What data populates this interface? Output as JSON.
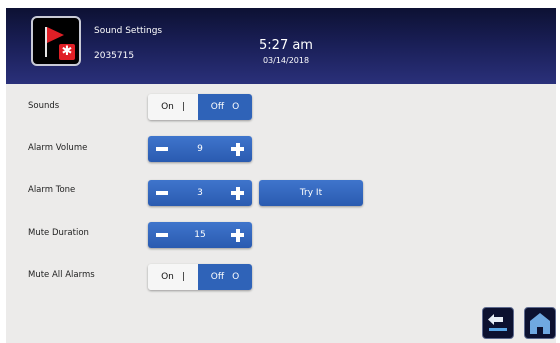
{
  "header": {
    "title": "Sound Settings",
    "device_id": "2035715",
    "time": "5:27 am",
    "date": "03/14/2018",
    "logo_icon": "red-flag-snowflake-icon"
  },
  "settings": {
    "sounds": {
      "label": "Sounds",
      "on_label": "On",
      "on_mark": "|",
      "off_label": "Off",
      "off_mark": "O",
      "selected": "Off"
    },
    "alarm_volume": {
      "label": "Alarm Volume",
      "value": "9"
    },
    "alarm_tone": {
      "label": "Alarm Tone",
      "value": "3",
      "try_label": "Try It"
    },
    "mute_duration": {
      "label": "Mute Duration",
      "value": "15"
    },
    "mute_all_alarms": {
      "label": "Mute All Alarms",
      "on_label": "On",
      "on_mark": "|",
      "off_label": "Off",
      "off_mark": "O",
      "selected": "Off"
    }
  },
  "nav": {
    "back_icon": "back-arrow-icon",
    "home_icon": "home-icon"
  },
  "colors": {
    "header_dark": "#0d1133",
    "header_light": "#2a307a",
    "accent_blue": "#2f63b8",
    "background": "#ecebea",
    "flag_red": "#e01f26"
  }
}
